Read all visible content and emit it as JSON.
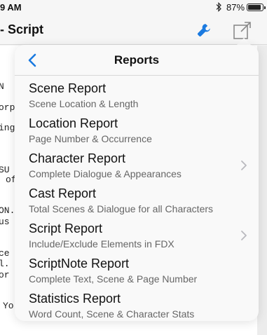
{
  "status_bar": {
    "time": "9 AM",
    "battery": "87%",
    "battery_level": 0.87,
    "bluetooth_icon": "bluetooth-icon"
  },
  "nav": {
    "title": "- Script",
    "tools_icon": "wrench-icon",
    "share_icon": "share-icon",
    "accent_color": "#1a7ae0"
  },
  "document": {
    "lines": [
      "N",
      "orp",
      "ing",
      "SU",
      "of",
      "ON.",
      "us",
      "ce",
      "l.",
      "or",
      "Yo"
    ]
  },
  "popover": {
    "title": "Reports",
    "back_icon": "chevron-left-icon",
    "items": [
      {
        "title": "Scene Report",
        "subtitle": "Scene Location & Length",
        "has_chevron": false
      },
      {
        "title": "Location Report",
        "subtitle": "Page Number & Occurrence",
        "has_chevron": false
      },
      {
        "title": "Character Report",
        "subtitle": "Complete Dialogue & Appearances",
        "has_chevron": true
      },
      {
        "title": "Cast Report",
        "subtitle": "Total Scenes & Dialogue for all Characters",
        "has_chevron": false
      },
      {
        "title": "Script Report",
        "subtitle": "Include/Exclude Elements in FDX",
        "has_chevron": true
      },
      {
        "title": "ScriptNote Report",
        "subtitle": "Complete Text, Scene & Page Number",
        "has_chevron": false
      },
      {
        "title": "Statistics Report",
        "subtitle": "Word Count, Scene & Character Stats",
        "has_chevron": false
      }
    ]
  }
}
